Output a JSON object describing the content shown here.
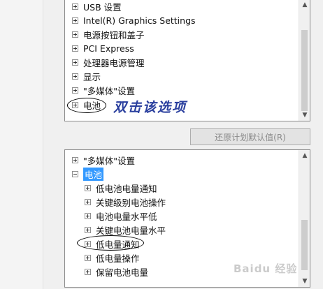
{
  "top_tree": {
    "items": [
      {
        "label": "USB 设置",
        "expanded": false
      },
      {
        "label": "Intel(R) Graphics Settings",
        "expanded": false
      },
      {
        "label": "电源按钮和盖子",
        "expanded": false
      },
      {
        "label": "PCI Express",
        "expanded": false
      },
      {
        "label": "处理器电源管理",
        "expanded": false
      },
      {
        "label": "显示",
        "expanded": false
      },
      {
        "label": "\"多媒体\"设置",
        "expanded": false
      },
      {
        "label": "电池",
        "expanded": false
      }
    ]
  },
  "restore_button_label": "还原计划默认值(R)",
  "bottom_tree": {
    "items": [
      {
        "label": "\"多媒体\"设置",
        "expanded": false,
        "level": 0
      },
      {
        "label": "电池",
        "expanded": true,
        "level": 0,
        "selected": true
      },
      {
        "label": "低电池电量通知",
        "expanded": false,
        "level": 1
      },
      {
        "label": "关键级别电池操作",
        "expanded": false,
        "level": 1
      },
      {
        "label": "电池电量水平低",
        "expanded": false,
        "level": 1
      },
      {
        "label": "关键电池电量水平",
        "expanded": false,
        "level": 1
      },
      {
        "label": "低电量通知",
        "expanded": false,
        "level": 1
      },
      {
        "label": "低电量操作",
        "expanded": false,
        "level": 1
      },
      {
        "label": "保留电池电量",
        "expanded": false,
        "level": 1
      }
    ]
  },
  "annotation_text": "双击该选项",
  "watermark": "Baidu 经验",
  "colors": {
    "selection": "#3399ff",
    "annotation": "#2a3f9e"
  }
}
